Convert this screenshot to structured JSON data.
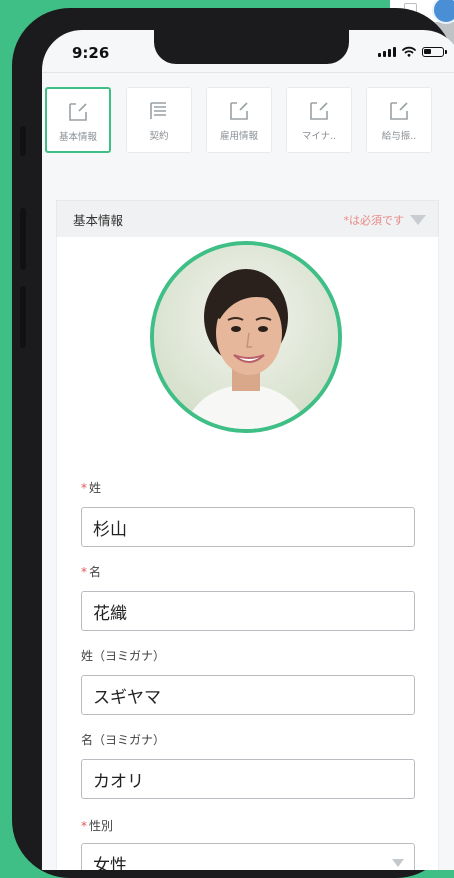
{
  "status_bar": {
    "time": "9:26"
  },
  "tabs": [
    {
      "label": "基本情報",
      "icon": "edit-note-icon",
      "active": true
    },
    {
      "label": "契約",
      "icon": "document-lines-icon",
      "active": false
    },
    {
      "label": "雇用情報",
      "icon": "edit-note-icon",
      "active": false
    },
    {
      "label": "マイナ..",
      "icon": "edit-note-icon",
      "active": false
    },
    {
      "label": "給与振..",
      "icon": "edit-note-icon",
      "active": false
    }
  ],
  "section": {
    "title": "基本情報",
    "required_note": "*は必須です"
  },
  "form": {
    "last_name": {
      "label": "姓",
      "required": true,
      "value": "杉山"
    },
    "first_name": {
      "label": "名",
      "required": true,
      "value": "花織"
    },
    "last_name_kana": {
      "label": "姓（ヨミガナ）",
      "required": false,
      "value": "スギヤマ"
    },
    "first_name_kana": {
      "label": "名（ヨミガナ）",
      "required": false,
      "value": "カオリ"
    },
    "gender": {
      "label": "性別",
      "required": true,
      "value": "女性"
    }
  },
  "colors": {
    "accent": "#3fbf86",
    "required": "#e05858",
    "note": "#e98a8a"
  }
}
